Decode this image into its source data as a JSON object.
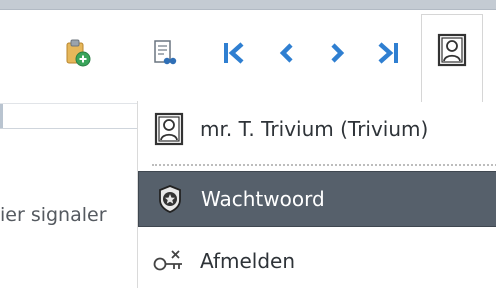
{
  "toolbar": {
    "buttons": [
      {
        "name": "clipboard-add",
        "icon": "clipboard-add-icon"
      },
      {
        "name": "document-view",
        "icon": "document-view-icon"
      },
      {
        "name": "first",
        "icon": "first-page-icon"
      },
      {
        "name": "previous",
        "icon": "chevron-left-icon"
      },
      {
        "name": "next",
        "icon": "chevron-right-icon"
      },
      {
        "name": "last",
        "icon": "last-page-icon"
      }
    ],
    "profile": {
      "icon": "user-portrait-icon"
    }
  },
  "content": {
    "partial_text": "ier signaler"
  },
  "menu": {
    "user": {
      "label": "mr. T. Trivium (Trivium)",
      "icon": "user-portrait-icon"
    },
    "password": {
      "label": "Wachtwoord",
      "icon": "badge-icon"
    },
    "logout": {
      "label": "Afmelden",
      "icon": "key-icon"
    }
  },
  "colors": {
    "nav_blue": "#2f7fd1",
    "menu_highlight": "#56606b",
    "clipboard": "#d9a441",
    "add_green": "#3aa55b"
  }
}
